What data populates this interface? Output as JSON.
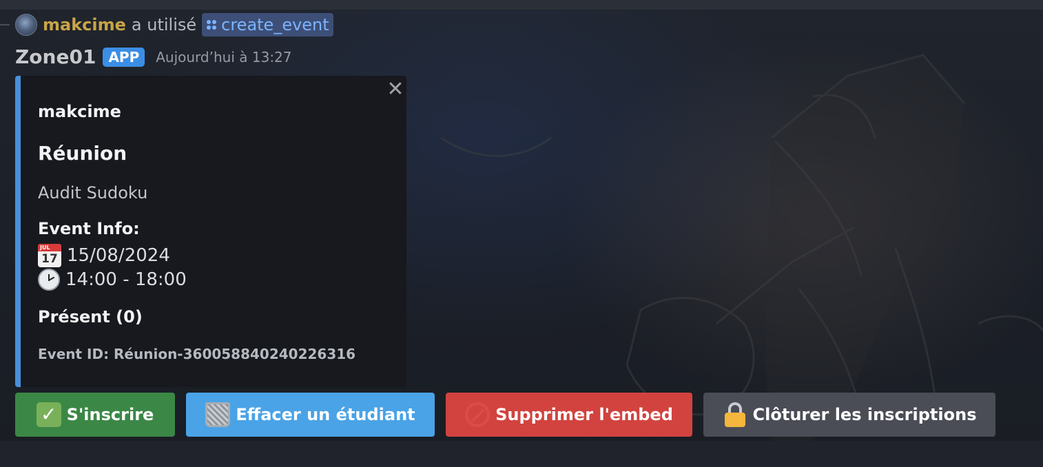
{
  "reply": {
    "username": "makcime",
    "action_text": "a utilisé",
    "command": "create_event"
  },
  "message": {
    "author": "Zone01",
    "badge": "APP",
    "timestamp": "Aujourd’hui à 13:27"
  },
  "embed": {
    "accent_color": "#4a90d9",
    "close_label": "✕",
    "author": "makcime",
    "title": "Réunion",
    "description": "Audit Sudoku",
    "field_name": "Event Info:",
    "calendar_month": "JUL",
    "calendar_day": "17",
    "date": "15/08/2024",
    "time": "14:00 - 18:00",
    "present": "Présent (0)",
    "footer": "Event ID: Réunion-360058840240226316"
  },
  "buttons": [
    {
      "label": "S'inscrire",
      "icon": "check-icon",
      "color": "#3b8746"
    },
    {
      "label": "Effacer un étudiant",
      "icon": "wastebasket-icon",
      "color": "#4aa3e6"
    },
    {
      "label": "Supprimer l'embed",
      "icon": "no-entry-icon",
      "color": "#d2433f"
    },
    {
      "label": "Clôturer les inscriptions",
      "icon": "lock-icon",
      "color": "#4a4d55"
    }
  ]
}
